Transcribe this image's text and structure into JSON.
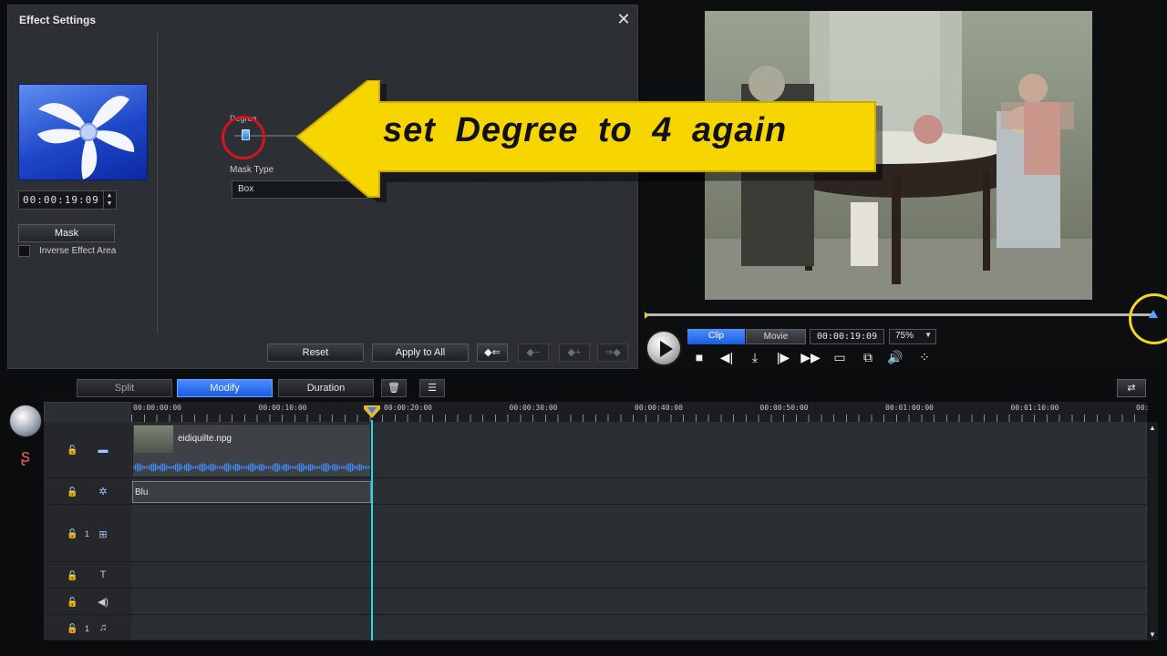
{
  "effect_settings": {
    "title": "Effect Settings",
    "close_label": "✕",
    "time_value": "00:00:19:09",
    "mask_button": "Mask",
    "inverse_label": "Inverse Effect Area",
    "degree_label": "Degree",
    "degree_value_fraction": 0.04,
    "mask_type_label": "Mask Type",
    "mask_type_value": "Box",
    "reset_button": "Reset",
    "apply_all_button": "Apply to All"
  },
  "tutorial_overlay": {
    "text": "set Degree to 4 again",
    "arrow_color": "#f7d600"
  },
  "preview": {
    "mode_clip": "Clip",
    "mode_movie": "Movie",
    "time": "00:00:19:09",
    "zoom": "75%",
    "accent": "#2a6ef0"
  },
  "toolbar": {
    "split": "Split",
    "modify": "Modify",
    "duration": "Duration"
  },
  "timeline": {
    "ruler_labels": [
      "00:00:00:00",
      "00:00:10:00",
      "00:00:20:00",
      "00:00:30:00",
      "00:00:40:00",
      "00:00:50:00",
      "00:01:00:00",
      "00:01:10:00",
      "00:"
    ],
    "video_clip_name": "eidiquilte.npg",
    "effect_clip_name": "Blu",
    "track_numbers": [
      "1",
      "1"
    ],
    "playhead_color": "#2ad4ec"
  }
}
